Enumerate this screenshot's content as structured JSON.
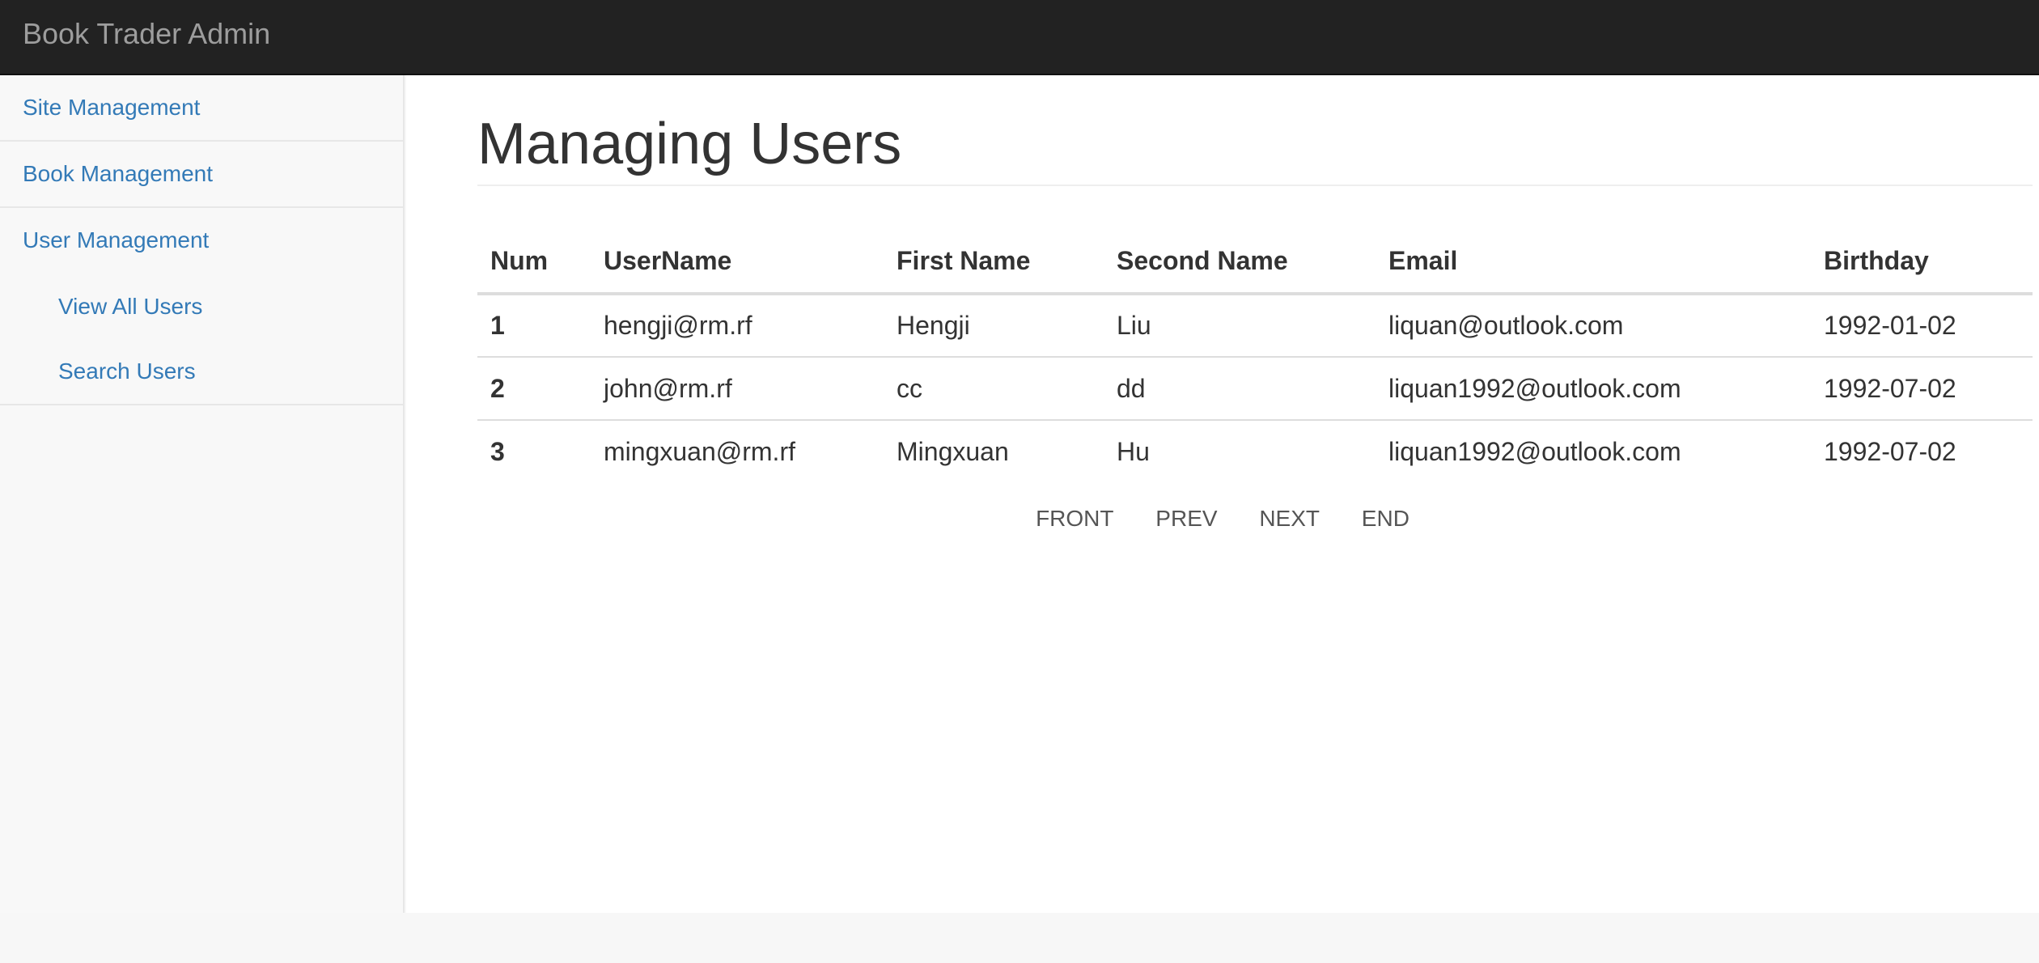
{
  "navbar": {
    "brand": "Book Trader Admin"
  },
  "sidebar": {
    "items": [
      {
        "label": "Site Management"
      },
      {
        "label": "Book Management"
      },
      {
        "label": "User Management"
      }
    ],
    "subitems": [
      {
        "label": "View All Users"
      },
      {
        "label": "Search Users"
      }
    ]
  },
  "main": {
    "title": "Managing Users",
    "table": {
      "headers": [
        "Num",
        "UserName",
        "First Name",
        "Second Name",
        "Email",
        "Birthday"
      ],
      "rows": [
        [
          "1",
          "hengji@rm.rf",
          "Hengji",
          "Liu",
          "liquan@outlook.com",
          "1992-01-02"
        ],
        [
          "2",
          "john@rm.rf",
          "cc",
          "dd",
          "liquan1992@outlook.com",
          "1992-07-02"
        ],
        [
          "3",
          "mingxuan@rm.rf",
          "Mingxuan",
          "Hu",
          "liquan1992@outlook.com",
          "1992-07-02"
        ]
      ]
    },
    "pager": {
      "front": "FRONT",
      "prev": "PREV",
      "next": "NEXT",
      "end": "END"
    }
  },
  "colors": {
    "navbar_bg": "#222222",
    "brand_text": "#9d9d9d",
    "link": "#337ab7",
    "sidebar_bg": "#f8f8f8",
    "text": "#333333"
  }
}
